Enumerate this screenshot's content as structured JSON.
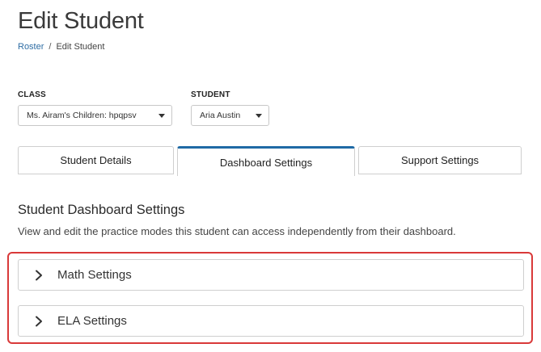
{
  "page": {
    "title": "Edit Student"
  },
  "breadcrumb": {
    "items": [
      "Roster",
      "Edit Student"
    ],
    "separator": "/"
  },
  "fields": {
    "class": {
      "label": "CLASS",
      "value": "Ms. Airam's Children: hpqpsv"
    },
    "student": {
      "label": "STUDENT",
      "value": "Aria Austin"
    }
  },
  "tabs": [
    {
      "label": "Student Details",
      "active": false
    },
    {
      "label": "Dashboard Settings",
      "active": true
    },
    {
      "label": "Support Settings",
      "active": false
    }
  ],
  "section": {
    "title": "Student Dashboard Settings",
    "description": "View and edit the practice modes this student can access independently from their dashboard."
  },
  "accordions": [
    {
      "label": "Math Settings",
      "icon": "chevron-right-icon"
    },
    {
      "label": "ELA Settings",
      "icon": "chevron-right-icon"
    }
  ],
  "colors": {
    "accent": "#1f6aa5",
    "link": "#2e6da4",
    "highlight": "#d93939"
  }
}
